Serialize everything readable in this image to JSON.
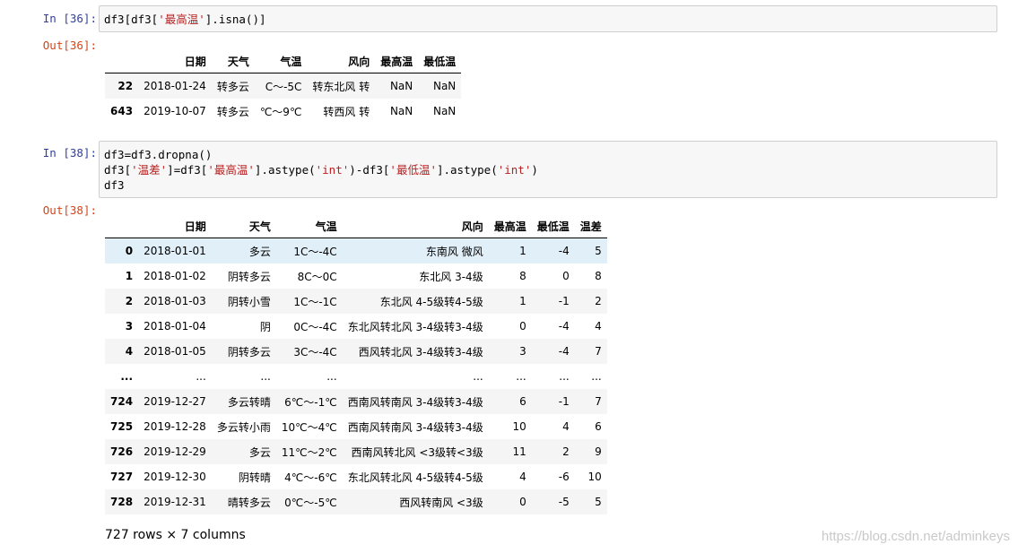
{
  "cell36": {
    "in_prompt": "In  [36]:",
    "code_a": "df3[df3[",
    "code_str": "'最高温'",
    "code_b": "].isna()]",
    "out_prompt": "Out[36]:",
    "table": {
      "columns": [
        "日期",
        "天气",
        "气温",
        "风向",
        "最高温",
        "最低温"
      ],
      "rows": [
        {
          "index": "22",
          "cells": [
            "2018-01-24",
            "转多云",
            "C～-5C",
            "转东北风 转",
            "NaN",
            "NaN"
          ]
        },
        {
          "index": "643",
          "cells": [
            "2019-10-07",
            "转多云",
            "℃～9℃",
            "转西风 转",
            "NaN",
            "NaN"
          ]
        }
      ]
    }
  },
  "cell38": {
    "in_prompt": "In  [38]:",
    "line1": "df3=df3.dropna()",
    "line2_a": "df3[",
    "line2_s1": "'温差'",
    "line2_b": "]=df3[",
    "line2_s2": "'最高温'",
    "line2_c": "].astype(",
    "line2_s3": "'int'",
    "line2_d": ")-df3[",
    "line2_s4": "'最低温'",
    "line2_e": "].astype(",
    "line2_s5": "'int'",
    "line2_f": ")",
    "line3": "df3",
    "out_prompt": "Out[38]:",
    "table": {
      "columns": [
        "日期",
        "天气",
        "气温",
        "风向",
        "最高温",
        "最低温",
        "温差"
      ],
      "rows": [
        {
          "index": "0",
          "cells": [
            "2018-01-01",
            "多云",
            "1C～-4C",
            "东南风 微风",
            "1",
            "-4",
            "5"
          ]
        },
        {
          "index": "1",
          "cells": [
            "2018-01-02",
            "阴转多云",
            "8C～0C",
            "东北风 3-4级",
            "8",
            "0",
            "8"
          ]
        },
        {
          "index": "2",
          "cells": [
            "2018-01-03",
            "阴转小雪",
            "1C～-1C",
            "东北风 4-5级转4-5级",
            "1",
            "-1",
            "2"
          ]
        },
        {
          "index": "3",
          "cells": [
            "2018-01-04",
            "阴",
            "0C～-4C",
            "东北风转北风 3-4级转3-4级",
            "0",
            "-4",
            "4"
          ]
        },
        {
          "index": "4",
          "cells": [
            "2018-01-05",
            "阴转多云",
            "3C～-4C",
            "西风转北风 3-4级转3-4级",
            "3",
            "-4",
            "7"
          ]
        },
        {
          "index": "...",
          "cells": [
            "...",
            "...",
            "...",
            "...",
            "...",
            "...",
            "..."
          ]
        },
        {
          "index": "724",
          "cells": [
            "2019-12-27",
            "多云转晴",
            "6℃～-1℃",
            "西南风转南风 3-4级转3-4级",
            "6",
            "-1",
            "7"
          ]
        },
        {
          "index": "725",
          "cells": [
            "2019-12-28",
            "多云转小雨",
            "10℃～4℃",
            "西南风转南风 3-4级转3-4级",
            "10",
            "4",
            "6"
          ]
        },
        {
          "index": "726",
          "cells": [
            "2019-12-29",
            "多云",
            "11℃～2℃",
            "西南风转北风 <3级转<3级",
            "11",
            "2",
            "9"
          ]
        },
        {
          "index": "727",
          "cells": [
            "2019-12-30",
            "阴转晴",
            "4℃～-6℃",
            "东北风转北风 4-5级转4-5级",
            "4",
            "-6",
            "10"
          ]
        },
        {
          "index": "728",
          "cells": [
            "2019-12-31",
            "晴转多云",
            "0℃～-5℃",
            "西风转南风 <3级",
            "0",
            "-5",
            "5"
          ]
        }
      ]
    },
    "shape": "727 rows × 7 columns"
  },
  "watermark": "https://blog.csdn.net/adminkeys"
}
